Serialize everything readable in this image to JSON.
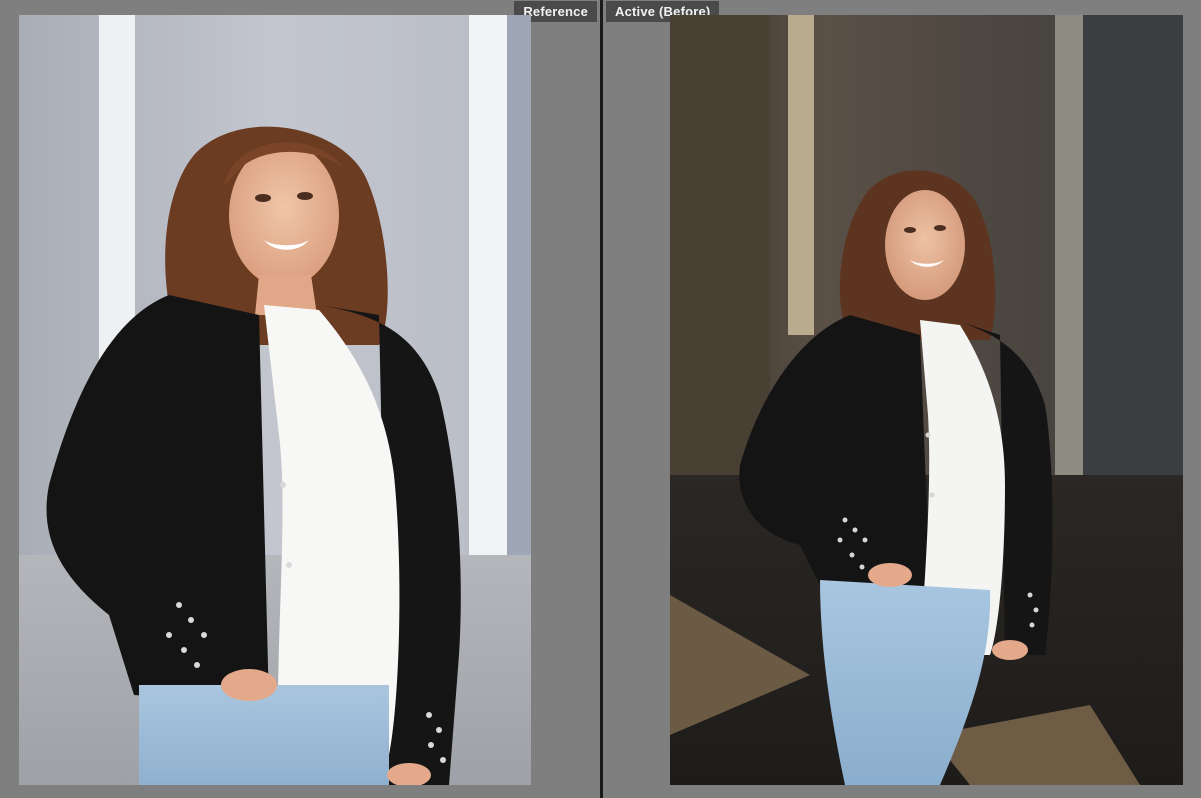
{
  "panes": {
    "reference": {
      "label": "Reference",
      "photo_icon": "portrait-photo-icon"
    },
    "active": {
      "label": "Active (Before)",
      "photo_icon": "portrait-photo-icon"
    }
  },
  "colors": {
    "background": "#7f7f7f",
    "label_background": "#4a4a4a",
    "label_text": "#f2f2f2",
    "divider": "#1a1a1a"
  }
}
